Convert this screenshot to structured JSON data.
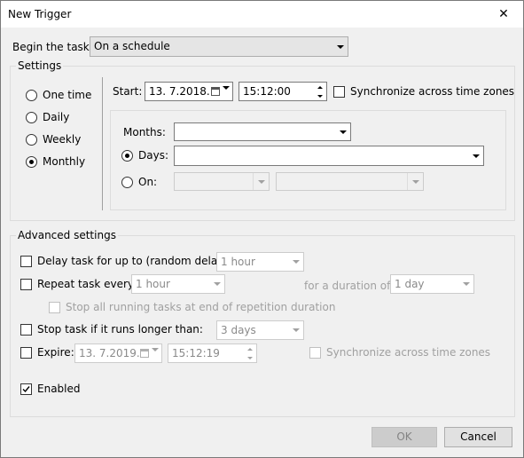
{
  "window": {
    "title": "New Trigger",
    "close_glyph": "✕"
  },
  "begin": {
    "label": "Begin the task:",
    "value": "On a schedule"
  },
  "settings": {
    "legend": "Settings",
    "frequency": [
      "One time",
      "Daily",
      "Weekly",
      "Monthly"
    ],
    "selected_frequency": "Monthly",
    "start_label": "Start:",
    "start_date": "13.  7.2018.",
    "start_time": "15:12:00",
    "sync_label": "Synchronize across time zones",
    "months_label": "Months:",
    "months_value": "",
    "days_label": "Days:",
    "days_value": "",
    "on_label": "On:",
    "on_value_1": "",
    "on_value_2": ""
  },
  "advanced": {
    "legend": "Advanced settings",
    "delay_label": "Delay task for up to (random delay):",
    "delay_value": "1 hour",
    "repeat_label": "Repeat task every:",
    "repeat_value": "1 hour",
    "duration_label": "for a duration of:",
    "duration_value": "1 day",
    "stop_all_label": "Stop all running tasks at end of repetition duration",
    "stop_label": "Stop task if it runs longer than:",
    "stop_value": "3 days",
    "expire_label": "Expire:",
    "expire_date": "13.  7.2019.",
    "expire_time": "15:12:19",
    "expire_sync_label": "Synchronize across time zones",
    "enabled_label": "Enabled",
    "enabled": true
  },
  "buttons": {
    "ok": "OK",
    "cancel": "Cancel"
  },
  "icons": {
    "close": "close-icon",
    "dropdown": "chevron-down-icon",
    "calendar": "calendar-icon",
    "spinner": "spinner-icon",
    "checkmark": "checkmark-icon"
  }
}
